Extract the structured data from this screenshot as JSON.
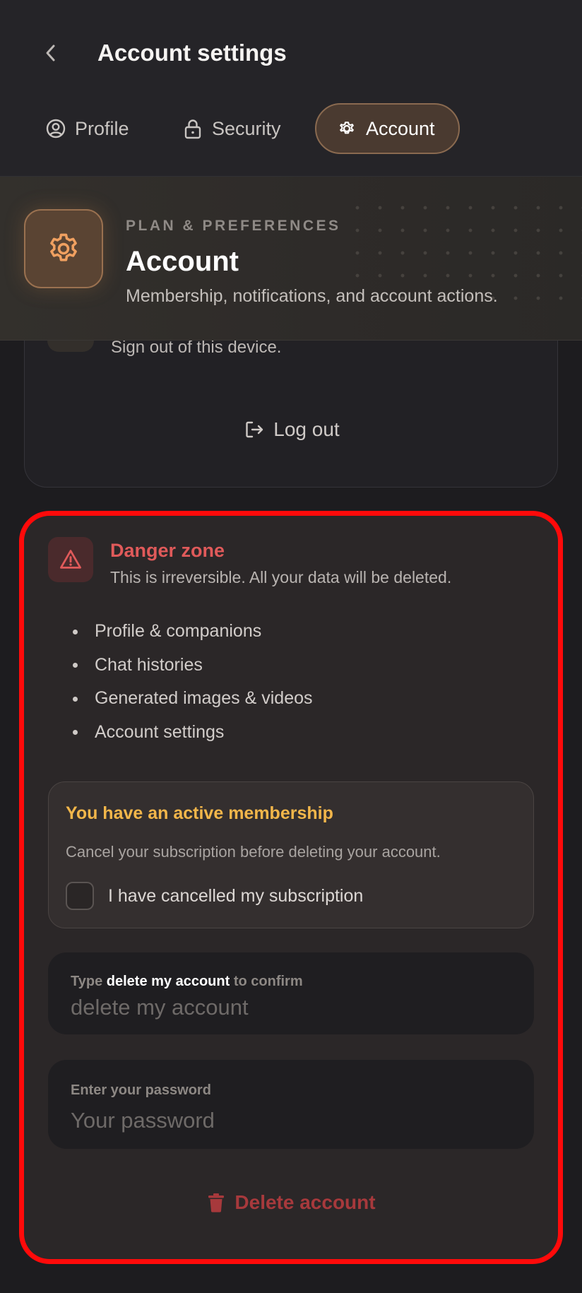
{
  "header": {
    "title": "Account settings"
  },
  "tabs": [
    {
      "label": "Profile",
      "icon": "user-circle-icon",
      "active": false
    },
    {
      "label": "Security",
      "icon": "lock-icon",
      "active": false
    },
    {
      "label": "Account",
      "icon": "gear-icon",
      "active": true
    }
  ],
  "section": {
    "eyebrow": "PLAN & PREFERENCES",
    "title": "Account",
    "subtitle": "Membership, notifications, and account actions.",
    "icon": "gear-icon",
    "accent": "#f0a060"
  },
  "logout": {
    "description": "Sign out of this device.",
    "button_label": "Log out"
  },
  "danger_zone": {
    "title": "Danger zone",
    "subtitle": "This is irreversible. All your data will be deleted.",
    "items": [
      "Profile & companions",
      "Chat histories",
      "Generated images & videos",
      "Account settings"
    ],
    "membership": {
      "title": "You have an active membership",
      "description": "Cancel your subscription before deleting your account.",
      "checkbox_label": "I have cancelled my subscription",
      "checked": false
    },
    "confirm_field": {
      "label_prefix": "Type",
      "label_phrase": "delete my account",
      "label_suffix": "to confirm",
      "placeholder": "delete my account",
      "value": ""
    },
    "password_field": {
      "label": "Enter your password",
      "placeholder": "Your password",
      "value": ""
    },
    "delete_button_label": "Delete account",
    "colors": {
      "danger": "#e05a5a",
      "warning": "#f2b64a",
      "highlight_border": "#ff0a0a"
    }
  }
}
